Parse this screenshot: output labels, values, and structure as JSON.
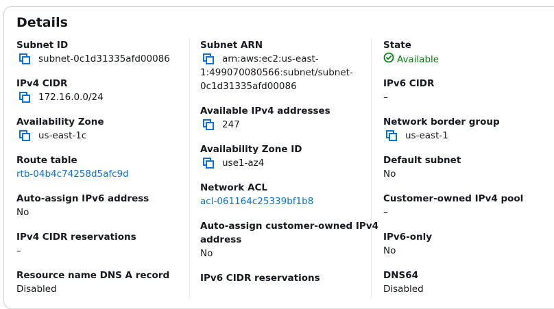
{
  "title": "Details",
  "col1": {
    "subnet_id": {
      "label": "Subnet ID",
      "value": "subnet-0c1d31335afd00086"
    },
    "ipv4_cidr": {
      "label": "IPv4 CIDR",
      "value": "172.16.0.0/24"
    },
    "availability_zone": {
      "label": "Availability Zone",
      "value": "us-east-1c"
    },
    "route_table": {
      "label": "Route table",
      "value": "rtb-04b4c74258d5afc9d"
    },
    "auto_assign_ipv6": {
      "label": "Auto-assign IPv6 address",
      "value": "No"
    },
    "ipv4_cidr_reservations": {
      "label": "IPv4 CIDR reservations",
      "value": "–"
    },
    "resource_name_dns": {
      "label": "Resource name DNS A record",
      "value": "Disabled"
    }
  },
  "col2": {
    "subnet_arn": {
      "label": "Subnet ARN",
      "line1": "arn:aws:ec2:us-east-",
      "line2": "1:499070080566:subnet/subnet-",
      "line3": "0c1d31335afd00086"
    },
    "available_ipv4": {
      "label": "Available IPv4 addresses",
      "value": "247"
    },
    "az_id": {
      "label": "Availability Zone ID",
      "value": "use1-az4"
    },
    "network_acl": {
      "label": "Network ACL",
      "value": "acl-061164c25339bf1b8"
    },
    "auto_assign_customer": {
      "label_line1": "Auto-assign customer-owned IPv4",
      "label_line2": "address",
      "value": "No"
    },
    "ipv6_cidr_reservations": {
      "label": "IPv6 CIDR reservations"
    }
  },
  "col3": {
    "state": {
      "label": "State",
      "value": "Available"
    },
    "ipv6_cidr": {
      "label": "IPv6 CIDR",
      "value": "–"
    },
    "network_border_group": {
      "label": "Network border group",
      "value": "us-east-1"
    },
    "default_subnet": {
      "label": "Default subnet",
      "value": "No"
    },
    "customer_owned_pool": {
      "label": "Customer-owned IPv4 pool",
      "value": "–"
    },
    "ipv6_only": {
      "label": "IPv6-only",
      "value": "No"
    },
    "dns64": {
      "label": "DNS64",
      "value": "Disabled"
    }
  },
  "colors": {
    "link": "#0972d3",
    "success": "#037f0c",
    "text": "#16191f"
  }
}
